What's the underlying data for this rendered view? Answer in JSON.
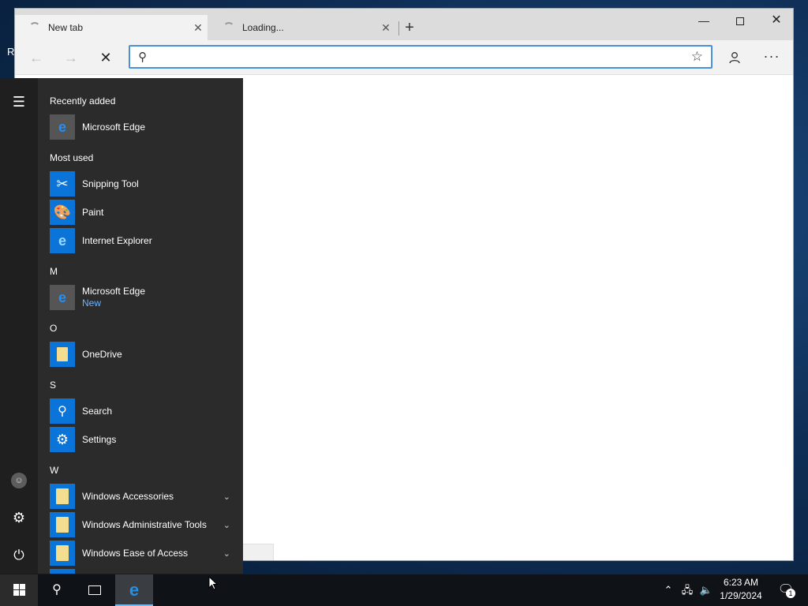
{
  "desktop": {
    "partial_label": "R"
  },
  "browser": {
    "tabs": [
      {
        "title": "New tab",
        "active": true,
        "close_label": "✕"
      },
      {
        "title": "Loading...",
        "active": false,
        "close_label": "✕"
      }
    ],
    "new_tab_label": "+",
    "window_controls": {
      "minimize": "—",
      "close": "✕"
    },
    "nav": {
      "back": "←",
      "forward": "→",
      "stop": "✕"
    },
    "address": {
      "value": "",
      "placeholder": ""
    },
    "favorite_icon": "☆",
    "profile_icon": "person-icon",
    "more_label": "···"
  },
  "start_menu": {
    "recently_added": {
      "heading": "Recently added",
      "items": [
        {
          "label": "Microsoft Edge",
          "icon": "edge-icon"
        }
      ]
    },
    "most_used": {
      "heading": "Most used",
      "items": [
        {
          "label": "Snipping Tool",
          "icon": "snipping-tool-icon"
        },
        {
          "label": "Paint",
          "icon": "paint-icon"
        },
        {
          "label": "Internet Explorer",
          "icon": "internet-explorer-icon"
        }
      ]
    },
    "groups": [
      {
        "letter": "M",
        "items": [
          {
            "label": "Microsoft Edge",
            "sub": "New",
            "icon": "edge-icon"
          }
        ]
      },
      {
        "letter": "O",
        "items": [
          {
            "label": "OneDrive",
            "icon": "onedrive-icon"
          }
        ]
      },
      {
        "letter": "S",
        "items": [
          {
            "label": "Search",
            "icon": "search-icon"
          },
          {
            "label": "Settings",
            "icon": "gear-icon"
          }
        ]
      },
      {
        "letter": "W",
        "items": [
          {
            "label": "Windows Accessories",
            "icon": "folder-icon",
            "expandable": true
          },
          {
            "label": "Windows Administrative Tools",
            "icon": "folder-icon",
            "expandable": true
          },
          {
            "label": "Windows Ease of Access",
            "icon": "folder-icon",
            "expandable": true
          }
        ]
      }
    ],
    "rail": {
      "hamburger": "☰",
      "settings": "⚙",
      "power": "⏻"
    }
  },
  "taskbar": {
    "clock_time": "6:23 AM",
    "clock_date": "1/29/2024",
    "notification_count": "1",
    "colors": {
      "taskbar_bg": "#0f1318",
      "active_underline": "#76b9ed",
      "accent": "#0a74d8"
    }
  }
}
